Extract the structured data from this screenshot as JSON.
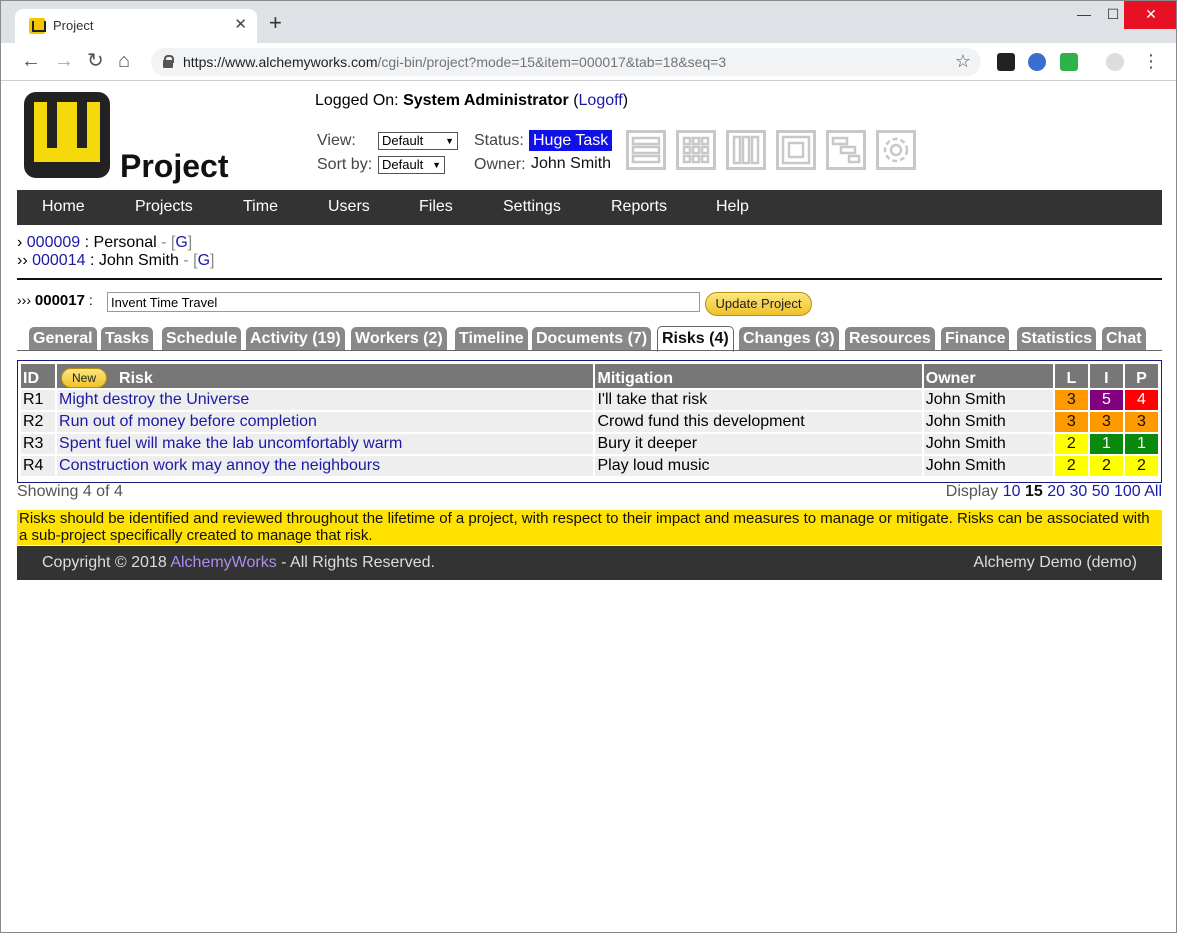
{
  "browser": {
    "tab_title": "Project",
    "url_host": "https://www.alchemyworks.com",
    "url_path": "/cgi-bin/project?mode=15&item=000017&tab=18&seq=3"
  },
  "header": {
    "app_title": "Project",
    "logged_label": "Logged On: ",
    "user": "System Administrator",
    "logoff": "Logoff",
    "view_label": "View:",
    "view_value": "Default",
    "sort_label": "Sort by:",
    "sort_value": "Default",
    "status_label": "Status:",
    "status_value": "Huge Task",
    "owner_label": "Owner:",
    "owner_value": "John Smith"
  },
  "menu": [
    "Home",
    "Projects",
    "Time",
    "Users",
    "Files",
    "Settings",
    "Reports",
    "Help"
  ],
  "breadcrumbs": [
    {
      "prefix": "›",
      "id": "000009",
      "name": "Personal",
      "g": "G"
    },
    {
      "prefix": "››",
      "id": "000014",
      "name": "John Smith",
      "g": "G"
    }
  ],
  "project": {
    "prefix": "›››",
    "id": "000017",
    "name": "Invent Time Travel",
    "update_label": "Update Project"
  },
  "tabs": [
    "General",
    "Tasks",
    "Schedule",
    "Activity (19)",
    "Workers (2)",
    "Timeline",
    "Documents (7)",
    "Risks (4)",
    "Changes (3)",
    "Resources",
    "Finance",
    "Statistics",
    "Chat"
  ],
  "risks": {
    "headers": {
      "id": "ID",
      "new": "New",
      "risk": "Risk",
      "mitigation": "Mitigation",
      "owner": "Owner",
      "l": "L",
      "i": "I",
      "p": "P"
    },
    "rows": [
      {
        "id": "R1",
        "risk": "Might destroy the Universe",
        "mitigation": "I'll take that risk",
        "owner": "John Smith",
        "l": "3",
        "i": "5",
        "p": "4"
      },
      {
        "id": "R2",
        "risk": "Run out of money before completion",
        "mitigation": "Crowd fund this development",
        "owner": "John Smith",
        "l": "3",
        "i": "3",
        "p": "3"
      },
      {
        "id": "R3",
        "risk": "Spent fuel will make the lab uncomfortably warm",
        "mitigation": "Bury it deeper",
        "owner": "John Smith",
        "l": "2",
        "i": "1",
        "p": "1"
      },
      {
        "id": "R4",
        "risk": "Construction work may annoy the neighbours",
        "mitigation": "Play loud music",
        "owner": "John Smith",
        "l": "2",
        "i": "2",
        "p": "2"
      }
    ],
    "showing": "Showing 4 of 4",
    "display_label": "Display",
    "display_options": [
      "10",
      "15",
      "20",
      "30",
      "50",
      "100",
      "All"
    ]
  },
  "score_colors": {
    "1": "#0a8a0a",
    "2": "#ffff00",
    "3": "#ff9900",
    "4": "#ff0000",
    "5": "#800080"
  },
  "note": "Risks should be identified and reviewed throughout the lifetime of a project, with respect to their impact and measures to manage or mitigate. Risks can be associated with a sub-project specifically created to manage that risk.",
  "footer": {
    "copyright_prefix": "Copyright © 2018 ",
    "company": "AlchemyWorks",
    "copyright_suffix": " - All Rights Reserved.",
    "instance": "Alchemy Demo (demo)"
  }
}
